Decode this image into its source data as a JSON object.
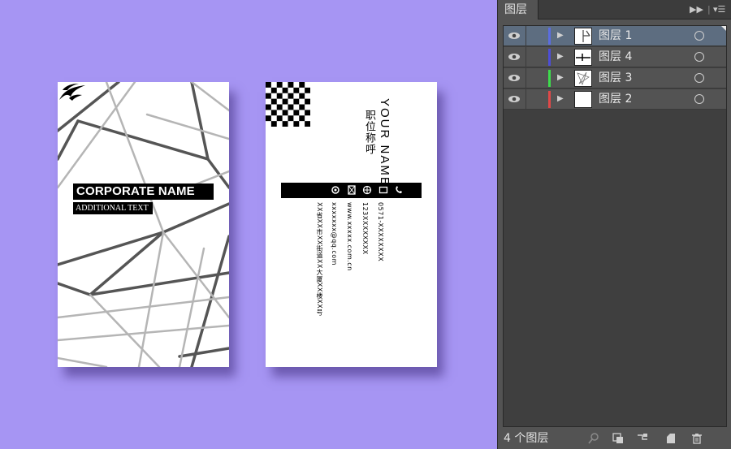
{
  "front_card": {
    "corporate_name": "CORPORATE NAME",
    "additional_text": "ADDITIONAL TEXT"
  },
  "back_card": {
    "your_name": "YOUR NAME",
    "job_title": "职位称呼",
    "phone": "0571-XXXXXXXX",
    "mobile": "123XXXXXXXX",
    "website": "www.xxxxx.com.cn",
    "email": "xxxxxxx@qq.com",
    "address": "XX省XX市XX街道XX大厦XX楼XX号",
    "icons": [
      "phone-icon",
      "mobile-icon",
      "web-icon",
      "mail-icon",
      "location-icon"
    ]
  },
  "layers_panel": {
    "title": "图层",
    "layers": [
      {
        "name": "图层 1",
        "color": "#5b6de0",
        "selected": true
      },
      {
        "name": "图层 4",
        "color": "#4d4ed8",
        "selected": false
      },
      {
        "name": "图层 3",
        "color": "#3ddc4c",
        "selected": false
      },
      {
        "name": "图层 2",
        "color": "#e04848",
        "selected": false
      }
    ],
    "count_label": "4 个图层"
  },
  "colors": {
    "canvas_bg": "#a695f3",
    "panel_bg": "#535353",
    "selected_row": "#5d6d80"
  }
}
